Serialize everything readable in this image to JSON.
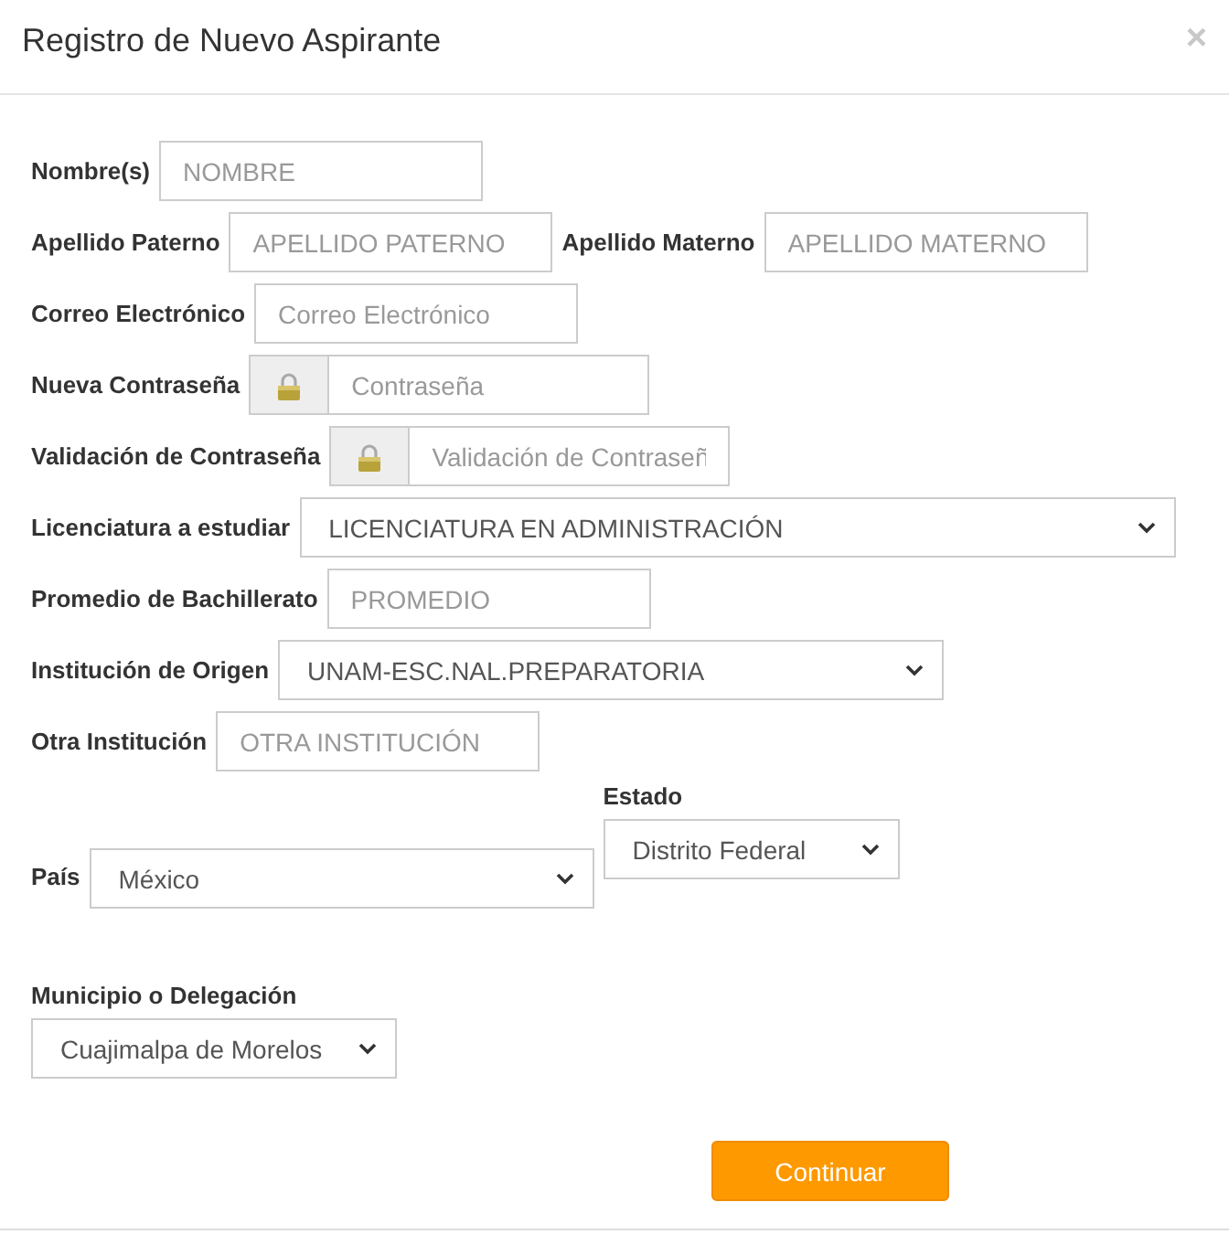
{
  "dialog": {
    "title": "Registro de Nuevo Aspirante",
    "close": "×"
  },
  "fields": [
    {
      "kind": "text",
      "label": "Nombre(s)",
      "placeholder": "NOMBRE"
    },
    {
      "kind": "text",
      "label": "Apellido Paterno",
      "placeholder": "APELLIDO PATERNO"
    },
    {
      "kind": "text",
      "label": "Apellido Materno",
      "placeholder": "APELLIDO MATERNO"
    },
    {
      "kind": "text",
      "label": "Correo Electrónico",
      "placeholder": "Correo Electrónico"
    },
    {
      "kind": "password",
      "label": "Nueva Contraseña",
      "placeholder": "Contraseña"
    },
    {
      "kind": "password",
      "label": "Validación de Contraseña",
      "placeholder": "Validación de Contraseñ"
    },
    {
      "kind": "select",
      "label": "Licenciatura a estudiar",
      "value": "LICENCIATURA EN ADMINISTRACIÓN"
    },
    {
      "kind": "text",
      "label": "Promedio de Bachillerato",
      "placeholder": "PROMEDIO"
    },
    {
      "kind": "select",
      "label": "Institución de Origen",
      "value": "UNAM-ESC.NAL.PREPARATORIA"
    },
    {
      "kind": "text",
      "label": "Otra Institución",
      "placeholder": "OTRA INSTITUCIÓN"
    },
    {
      "kind": "select",
      "label": "País",
      "value": "México"
    },
    {
      "kind": "select",
      "label": "Estado",
      "value": "Distrito Federal"
    },
    {
      "kind": "select",
      "label": "Municipio o Delegación",
      "value": "Cuajimalpa de Morelos"
    }
  ],
  "buttons": [
    "Continuar"
  ]
}
